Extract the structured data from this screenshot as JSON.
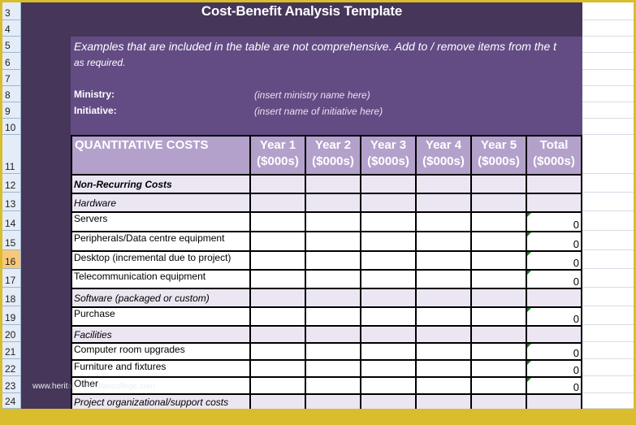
{
  "sheet": {
    "title": "Cost-Benefit Analysis Template",
    "note_line1": "Examples that are included in the table are not comprehensive.  Add to / remove items from the t",
    "note_line2": "as required.",
    "ministry_label": "Ministry:",
    "ministry_placeholder": "(insert ministry name here)",
    "initiative_label": "Initiative:",
    "initiative_placeholder": "(insert name of initiative here)",
    "active_row": "16"
  },
  "row_headers": [
    "3",
    "4",
    "5",
    "6",
    "7",
    "8",
    "9",
    "10",
    "11",
    "12",
    "13",
    "14",
    "15",
    "16",
    "17",
    "18",
    "19",
    "20",
    "21",
    "22",
    "23",
    "24"
  ],
  "table": {
    "header": {
      "category": "QUANTITATIVE COSTS",
      "columns": [
        {
          "line1": "Year 1",
          "line2": "($000s)"
        },
        {
          "line1": "Year 2",
          "line2": "($000s)"
        },
        {
          "line1": "Year 3",
          "line2": "($000s)"
        },
        {
          "line1": "Year 4",
          "line2": "($000s)"
        },
        {
          "line1": "Year 5",
          "line2": "($000s)"
        },
        {
          "line1": "Total",
          "line2": "($000s)"
        }
      ]
    },
    "rows": [
      {
        "label": "Non-Recurring Costs",
        "kind": "sec",
        "total": ""
      },
      {
        "label": "Hardware",
        "kind": "sub",
        "total": ""
      },
      {
        "label": "Servers",
        "kind": "item",
        "total": "0"
      },
      {
        "label": "Peripherals/Data centre equipment",
        "kind": "item",
        "total": "0"
      },
      {
        "label": "Desktop (incremental due to project)",
        "kind": "item",
        "total": "0"
      },
      {
        "label": "Telecommunication equipment",
        "kind": "item",
        "total": "0"
      },
      {
        "label": "Software (packaged or custom)",
        "kind": "sub",
        "total": ""
      },
      {
        "label": "Purchase",
        "kind": "item",
        "total": "0"
      },
      {
        "label": "Facilities",
        "kind": "sub",
        "total": ""
      },
      {
        "label": "Computer room upgrades",
        "kind": "item",
        "total": "0"
      },
      {
        "label": "Furniture and fixtures",
        "kind": "item",
        "total": "0"
      },
      {
        "label": "Other",
        "kind": "item",
        "total": "0"
      },
      {
        "label": "Project organizational/support costs",
        "kind": "sub",
        "total": ""
      }
    ]
  },
  "watermark": {
    "visible": "www.herit",
    "faded": "agechristiancollege.com"
  },
  "colors": {
    "dark_band": "#45365a",
    "purple_box": "#634c84",
    "header_fill": "#b3a1cb",
    "subheader_fill": "#ebe6f2",
    "frame": "#d9bd2c",
    "error_flag": "#1e7a1e"
  }
}
